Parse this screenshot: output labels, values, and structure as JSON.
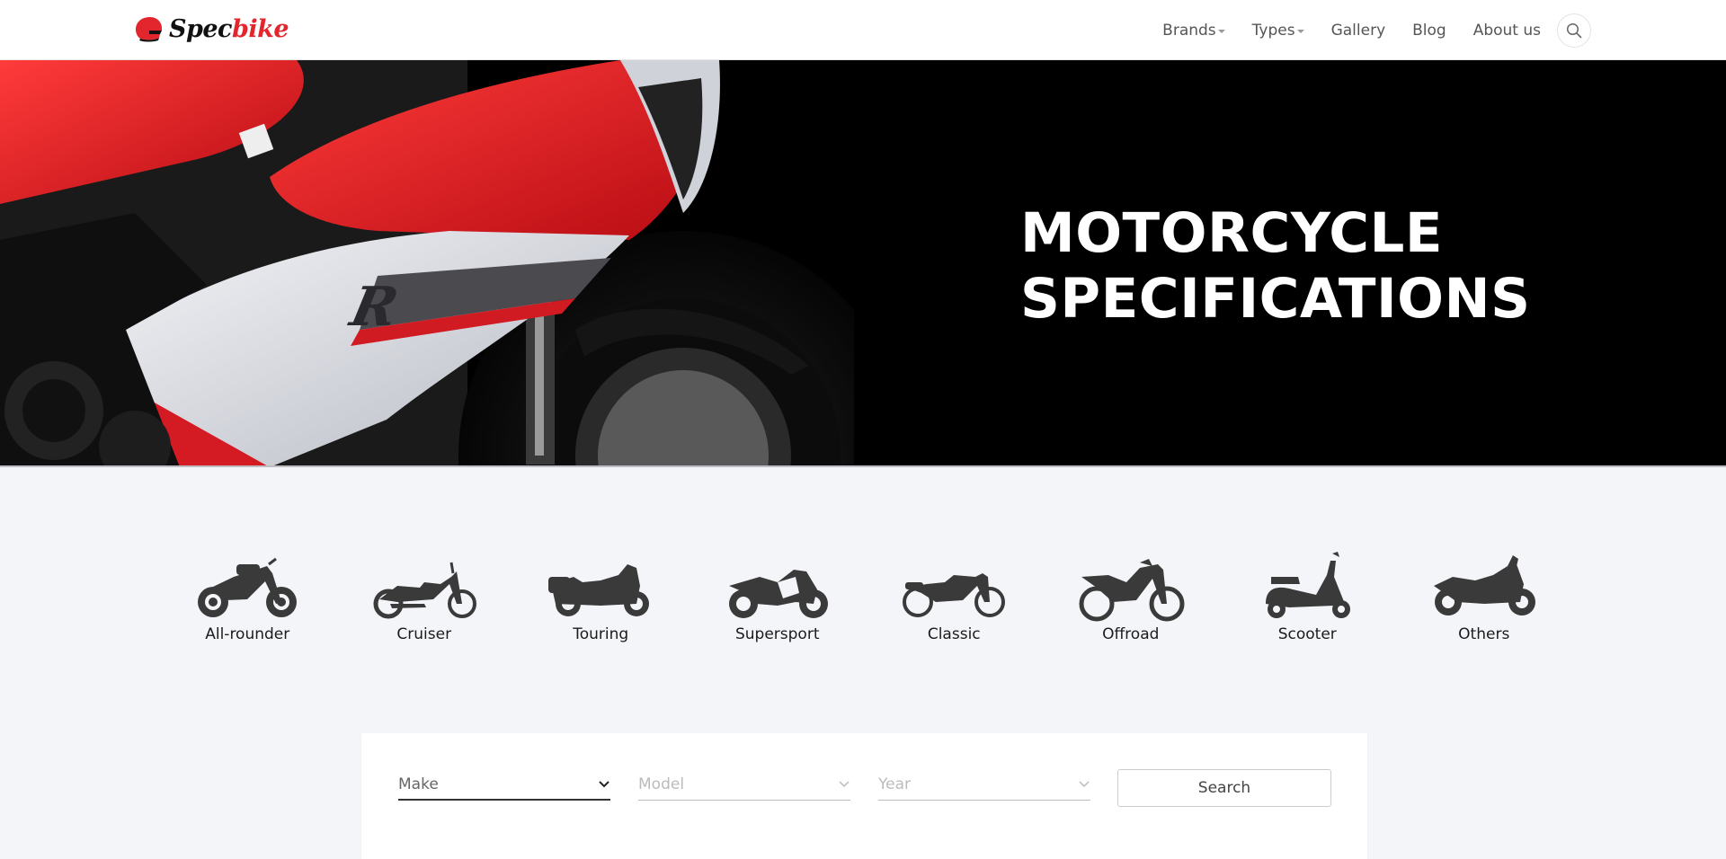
{
  "brand": {
    "name_part1": "Spec",
    "name_part2": "bike"
  },
  "nav": {
    "items": [
      {
        "label": "Brands",
        "dropdown": true
      },
      {
        "label": "Types",
        "dropdown": true
      },
      {
        "label": "Gallery",
        "dropdown": false
      },
      {
        "label": "Blog",
        "dropdown": false
      },
      {
        "label": "About us",
        "dropdown": false
      }
    ],
    "search_icon": "search-icon"
  },
  "hero": {
    "title_line1": "MOTORCYCLE",
    "title_line2": "SPECIFICATIONS"
  },
  "categories": [
    {
      "label": "All-rounder",
      "icon": "all-rounder-motorcycle-icon"
    },
    {
      "label": "Cruiser",
      "icon": "cruiser-motorcycle-icon"
    },
    {
      "label": "Touring",
      "icon": "touring-motorcycle-icon"
    },
    {
      "label": "Supersport",
      "icon": "supersport-motorcycle-icon"
    },
    {
      "label": "Classic",
      "icon": "classic-motorcycle-icon"
    },
    {
      "label": "Offroad",
      "icon": "offroad-motorcycle-icon"
    },
    {
      "label": "Scooter",
      "icon": "scooter-icon"
    },
    {
      "label": "Others",
      "icon": "trike-motorcycle-icon"
    }
  ],
  "search": {
    "make": {
      "value": "Make",
      "enabled": true
    },
    "model": {
      "value": "Model",
      "enabled": false
    },
    "year": {
      "value": "Year",
      "enabled": false
    },
    "button_label": "Search"
  },
  "colors": {
    "accent": "#e3262e",
    "hero_bg": "#000000",
    "page_bg": "#f4f5f9"
  }
}
